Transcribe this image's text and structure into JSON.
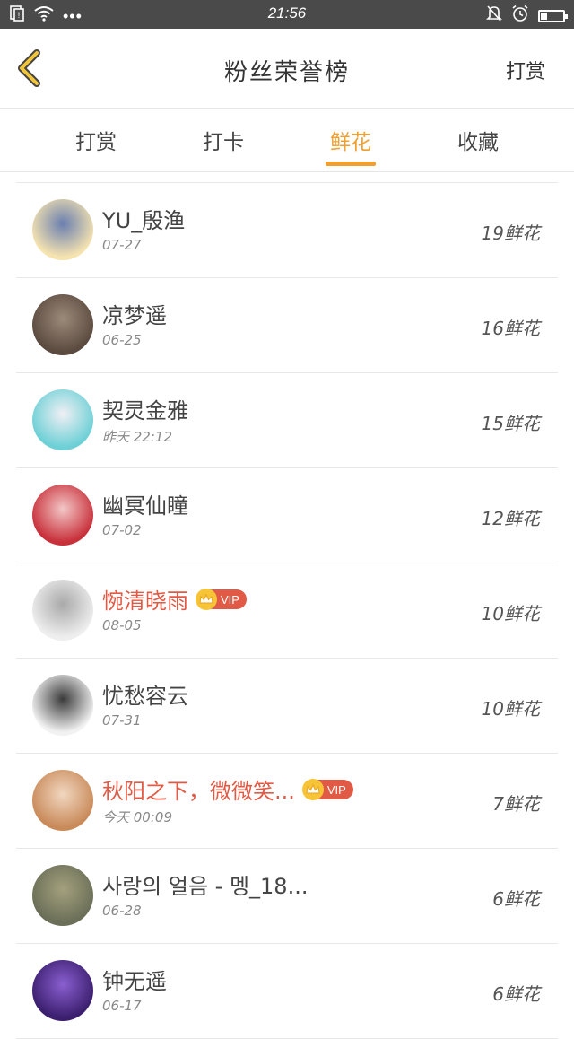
{
  "status_bar": {
    "time": "21:56",
    "dots": "•••",
    "battery_level": 0.3
  },
  "header": {
    "title": "粉丝荣誉榜",
    "right_action": "打赏"
  },
  "tabs": [
    {
      "label": "打赏",
      "active": false
    },
    {
      "label": "打卡",
      "active": false
    },
    {
      "label": "鲜花",
      "active": true
    },
    {
      "label": "收藏",
      "active": false
    }
  ],
  "list": [
    {
      "name": "YU_殷渔",
      "date": "07-27",
      "count": "19鲜花",
      "vip": false,
      "avatar_colors": [
        "#f5e3b0",
        "#6a7fb0"
      ]
    },
    {
      "name": "凉梦遥",
      "date": "06-25",
      "count": "16鲜花",
      "vip": false,
      "avatar_colors": [
        "#5b4a3f",
        "#9c8a7a"
      ]
    },
    {
      "name": "契灵金雅",
      "date": "昨天 22:12",
      "count": "15鲜花",
      "vip": false,
      "avatar_colors": [
        "#6dd0d6",
        "#f0f0f5"
      ]
    },
    {
      "name": "幽冥仙瞳",
      "date": "07-02",
      "count": "12鲜花",
      "vip": false,
      "avatar_colors": [
        "#c8303a",
        "#f3c7c7"
      ]
    },
    {
      "name": "惋清晓雨",
      "date": "08-05",
      "count": "10鲜花",
      "vip": true,
      "vip_label": "VIP",
      "avatar_colors": [
        "#eeeeee",
        "#a9a9a9"
      ]
    },
    {
      "name": "忧愁容云",
      "date": "07-31",
      "count": "10鲜花",
      "vip": false,
      "avatar_colors": [
        "#f2f2f2",
        "#3a3a3a"
      ]
    },
    {
      "name": "秋阳之下，微微笑...",
      "date": "今天 00:09",
      "count": "7鲜花",
      "vip": true,
      "vip_label": "VIP",
      "avatar_colors": [
        "#c98a5a",
        "#f1d7c0"
      ]
    },
    {
      "name": "사랑의 얼음 - 멩_18...",
      "date": "06-28",
      "count": "6鲜花",
      "vip": false,
      "avatar_colors": [
        "#6b6f58",
        "#a3a07d"
      ]
    },
    {
      "name": "钟无遥",
      "date": "06-17",
      "count": "6鲜花",
      "vip": false,
      "avatar_colors": [
        "#3b1f6e",
        "#8a5fd0"
      ]
    }
  ],
  "colors": {
    "accent": "#f0a030",
    "vip_red": "#e05a45",
    "status_bar_bg": "#4a4a4a"
  }
}
